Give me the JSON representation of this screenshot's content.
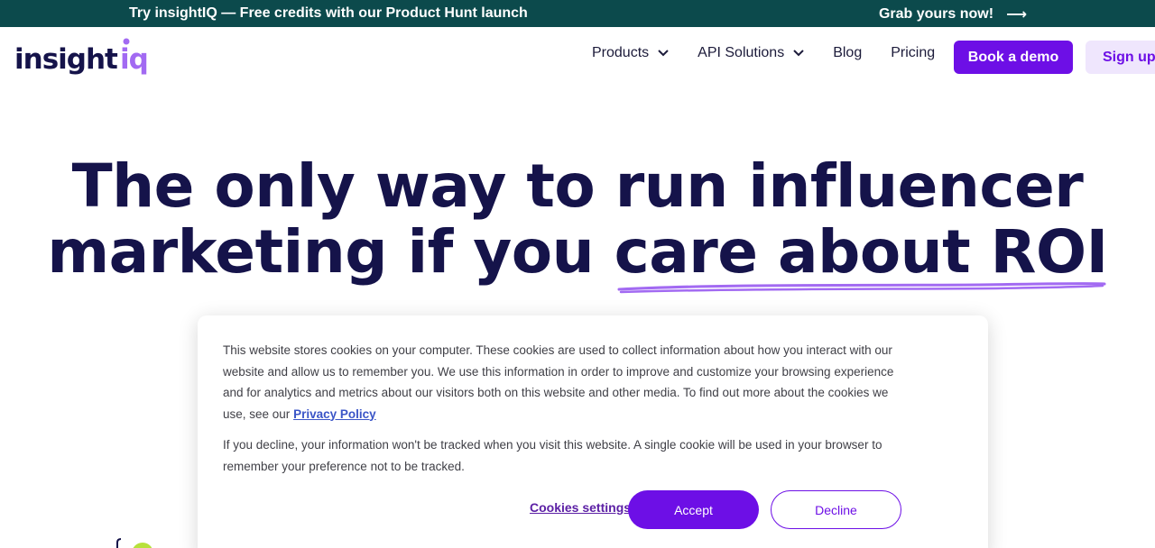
{
  "announcement": {
    "promo_text": "Try insightIQ — Free credits with our Product Hunt launch",
    "cta_text": "Grab yours now!",
    "arrow_icon": "arrow-right-icon",
    "background": "#0c4a4c"
  },
  "nav": {
    "logo_text": "insightiq",
    "items": [
      {
        "label": "Products",
        "has_dropdown": true
      },
      {
        "label": "API Solutions",
        "has_dropdown": true
      },
      {
        "label": "Blog",
        "has_dropdown": false
      },
      {
        "label": "Pricing",
        "has_dropdown": false
      }
    ],
    "book_demo_label": "Book a demo",
    "signup_label": "Sign up"
  },
  "hero": {
    "title_line1": "The only way to run influencer",
    "title_line2_plain": "marketing if you ",
    "title_line2_highlight": "care about ROI",
    "highlight_color": "#a26af2"
  },
  "cookie_banner": {
    "paragraph1": "This website stores cookies on your computer. These cookies are used to collect information about how you interact with our website and allow us to remember you. We use this information in order to improve and customize your browsing experience and for analytics and metrics about our visitors both on this website and other media. To find out more about the cookies we use, see our",
    "privacy_link": "Privacy Policy",
    "paragraph2": "If you decline, your information won't be tracked when you visit this website. A single cookie will be used in your browser to remember your preference not to be tracked.",
    "settings_label": "Cookies settings",
    "accept_label": "Accept",
    "decline_label": "Decline"
  },
  "colors": {
    "brand_purple": "#6d0fe6",
    "heading_navy": "#15134a",
    "signup_bg": "#efe6fd"
  }
}
